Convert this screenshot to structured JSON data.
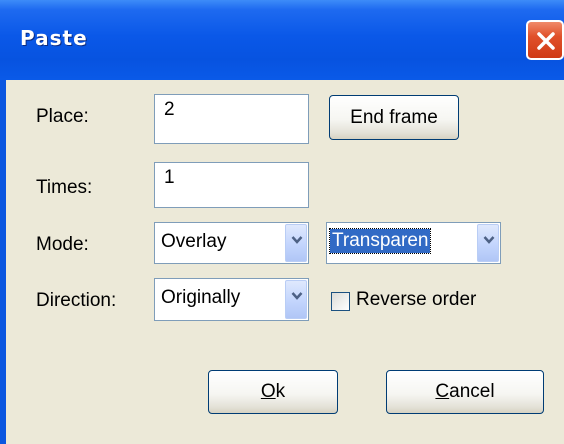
{
  "dialog": {
    "title": "Paste",
    "close_icon": "close-icon"
  },
  "fields": {
    "place_label": "Place:",
    "place_value": "2",
    "end_frame_label": "End frame",
    "times_label": "Times:",
    "times_value": "1",
    "mode_label": "Mode:",
    "mode_value": "Overlay",
    "blend_value": "Transparen",
    "direction_label": "Direction:",
    "direction_value": "Originally",
    "reverse_order_label": "Reverse order",
    "reverse_order_checked": false
  },
  "buttons": {
    "ok_accel": "O",
    "ok_rest": "k",
    "cancel_accel": "C",
    "cancel_rest": "ancel"
  },
  "colors": {
    "titlebar": "#0a58e8",
    "close_button": "#d03a14",
    "client_bg": "#ece9d8",
    "selection": "#316ac5"
  }
}
